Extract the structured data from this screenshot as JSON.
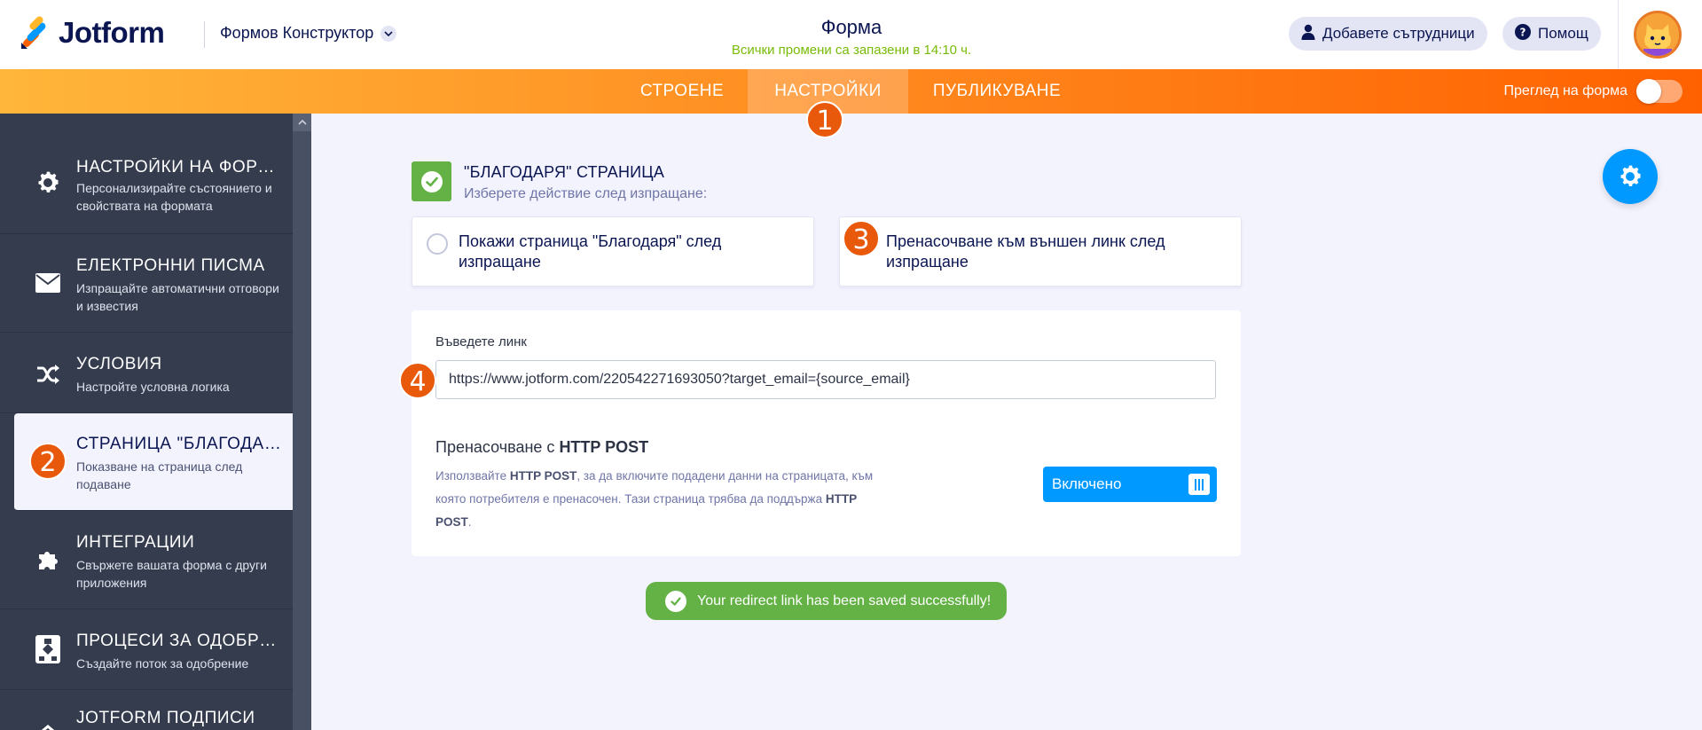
{
  "header": {
    "brand": "Jotform",
    "builder_menu": "Формов Конструктор",
    "form_title": "Форма",
    "save_status": "Всички промени са запазени в 14:10 ч.",
    "add_collaborators": "Добавете сътрудници",
    "help": "Помощ"
  },
  "navbar": {
    "tabs": [
      {
        "label": "СТРОЕНЕ",
        "active": false
      },
      {
        "label": "НАСТРОЙКИ",
        "active": true
      },
      {
        "label": "ПУБЛИКУВАНЕ",
        "active": false
      }
    ],
    "preview_label": "Преглед на форма",
    "preview_on": false
  },
  "badges": [
    "1",
    "2",
    "3",
    "4"
  ],
  "sidebar": {
    "items": [
      {
        "title": "НАСТРОЙКИ НА ФОРМ...",
        "desc": "Персонализирайте състоянието и свойствата на формата",
        "icon": "gear-icon"
      },
      {
        "title": "ЕЛЕКТРОННИ ПИСМА",
        "desc": "Изпращайте автоматични отговори и известия",
        "icon": "envelope-icon"
      },
      {
        "title": "УСЛОВИЯ",
        "desc": "Настройте условна логика",
        "icon": "shuffle-icon"
      },
      {
        "title": "СТРАНИЦА \"БЛАГОДАРЯ\"",
        "desc": "Показване на страница след подаване",
        "icon": "thank-you-icon",
        "active": true
      },
      {
        "title": "ИНТЕГРАЦИИ",
        "desc": "Свържете вашата форма с други приложения",
        "icon": "puzzle-icon"
      },
      {
        "title": "ПРОЦЕСИ ЗА ОДОБРЕН...",
        "desc": "Създайте поток за одобрение",
        "icon": "flow-icon"
      },
      {
        "title": "JOTFORM ПОДПИСИ",
        "desc": "",
        "icon": "signature-icon"
      }
    ]
  },
  "thankyou": {
    "title": "\"БЛАГОДАРЯ\" СТРАНИЦА",
    "subtitle": "Изберете действие след изпращане:",
    "option_page": "Покажи страница \"Благодаря\" след изпращане",
    "option_redirect": "Пренасочване към външен линк след изпращане",
    "selected": "redirect"
  },
  "redirect": {
    "label": "Въведете линк",
    "url": "https://www.jotform.com/220542271693050?target_email={source_email}",
    "post_title_prefix": "Пренасочване с ",
    "post_title_bold": "HTTP POST",
    "desc_1": "Използвайте ",
    "desc_b1": "HTTP POST",
    "desc_2": ", за да включите подадени данни на страницата, към която потребителя е пренасочен. Тази страница трябва да поддържа ",
    "desc_b2": "HTTP POST",
    "desc_3": ".",
    "switch_label": "Включено",
    "switch_on": true
  },
  "toast": {
    "message": "Your redirect link has been saved successfully!"
  },
  "colors": {
    "navy": "#0a1551",
    "orange_start": "#ffb63a",
    "orange_end": "#ff6100",
    "badge": "#e8590c",
    "green": "#64b246",
    "blue": "#0099ff",
    "sidebar": "#343c4e",
    "save_green": "#78bb07"
  }
}
